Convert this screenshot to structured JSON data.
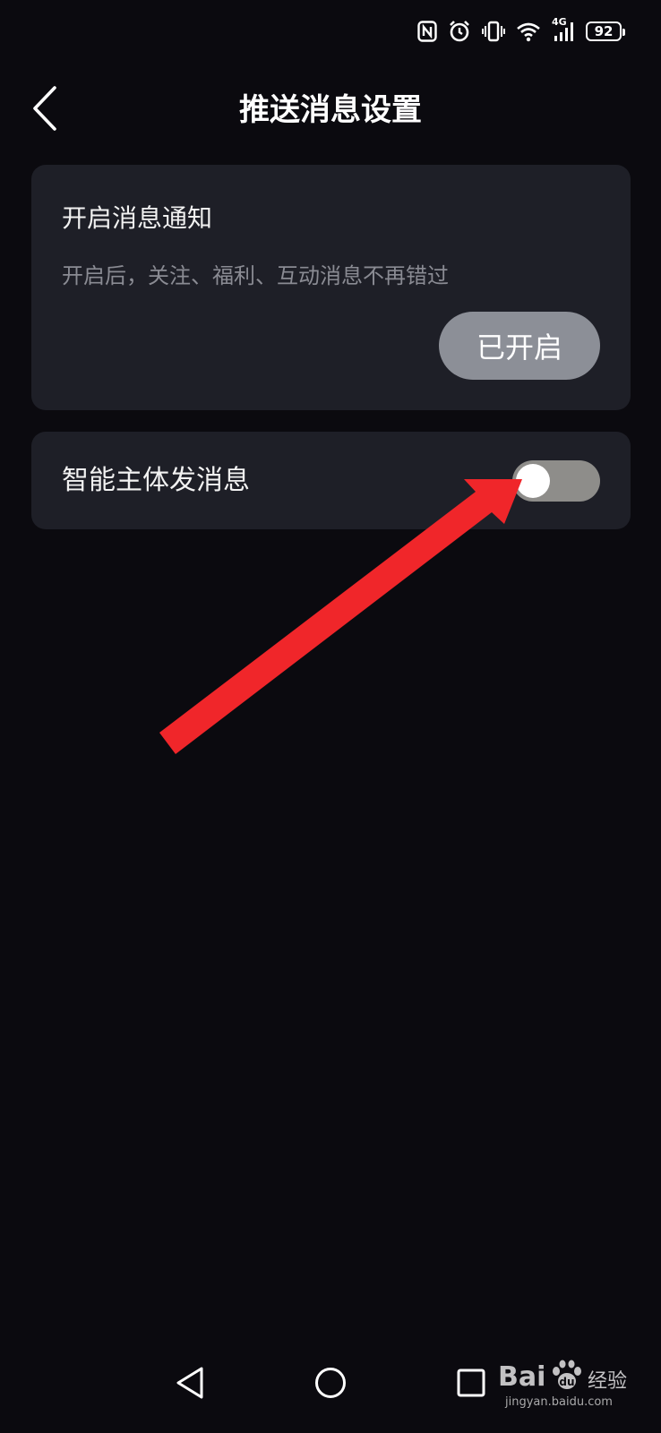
{
  "status_bar": {
    "network_label": "4G",
    "battery_level": "92"
  },
  "header": {
    "title": "推送消息设置"
  },
  "notification_card": {
    "title": "开启消息通知",
    "description": "开启后，关注、福利、互动消息不再错过",
    "button_label": "已开启"
  },
  "agent_card": {
    "label": "智能主体发消息",
    "toggle_on": false
  },
  "annotation": {
    "arrow_color": "#f0262a"
  },
  "watermark": {
    "brand": "Bai",
    "brand_suffix": "经验",
    "url": "jingyan.baidu.com"
  },
  "colors": {
    "background": "#0b0a0f",
    "card": "#1e1f27",
    "button": "#8c8f97",
    "toggle_track": "#8e8d8a"
  }
}
